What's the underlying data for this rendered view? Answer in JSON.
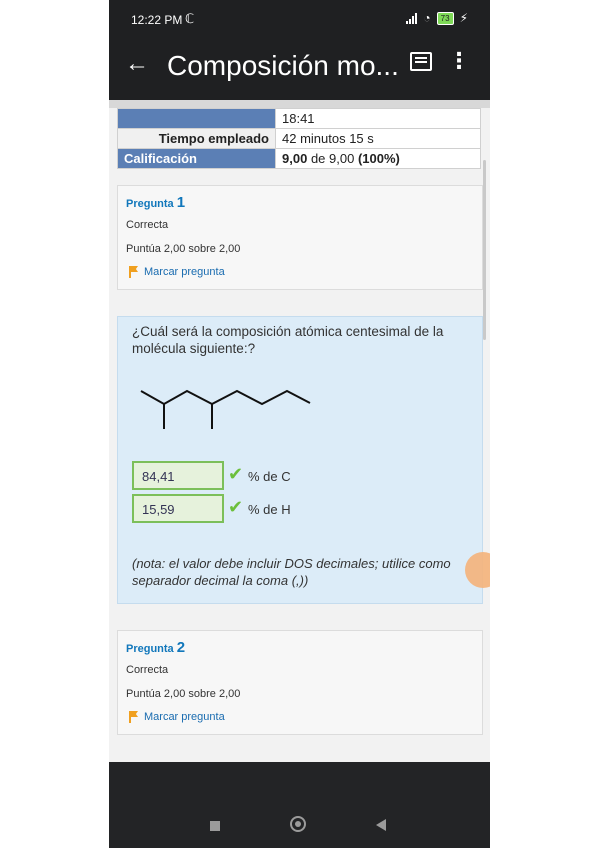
{
  "status": {
    "time": "12:22 PM",
    "battery": "73"
  },
  "appbar": {
    "title": "Composición mo...",
    "back_icon": "arrow-back-icon",
    "message_icon": "message-icon",
    "more_icon": "more-vert-icon"
  },
  "summary": {
    "time_value": "18:41",
    "elapsed_label": "Tiempo empleado",
    "elapsed_value": "42 minutos 15 s",
    "grade_label": "Calificación",
    "grade_score": "9,00",
    "grade_mid": "de 9,00",
    "grade_pct": "(100%)"
  },
  "question1": {
    "label": "Pregunta",
    "number": "1",
    "state": "Correcta",
    "score": "Puntúa 2,00 sobre 2,00",
    "flag_label": "Marcar pregunta",
    "text": "¿Cuál será la composición atómica centesimal de la molécula siguiente:?",
    "answers": [
      {
        "value": "84,41",
        "unit": "% de C"
      },
      {
        "value": "15,59",
        "unit": "% de H"
      }
    ],
    "note": "(nota: el valor debe incluir DOS decimales; utilice como separador decimal la coma (,))"
  },
  "question2": {
    "label": "Pregunta",
    "number": "2",
    "state": "Correcta",
    "score": "Puntúa 2,00 sobre 2,00",
    "flag_label": "Marcar pregunta"
  }
}
